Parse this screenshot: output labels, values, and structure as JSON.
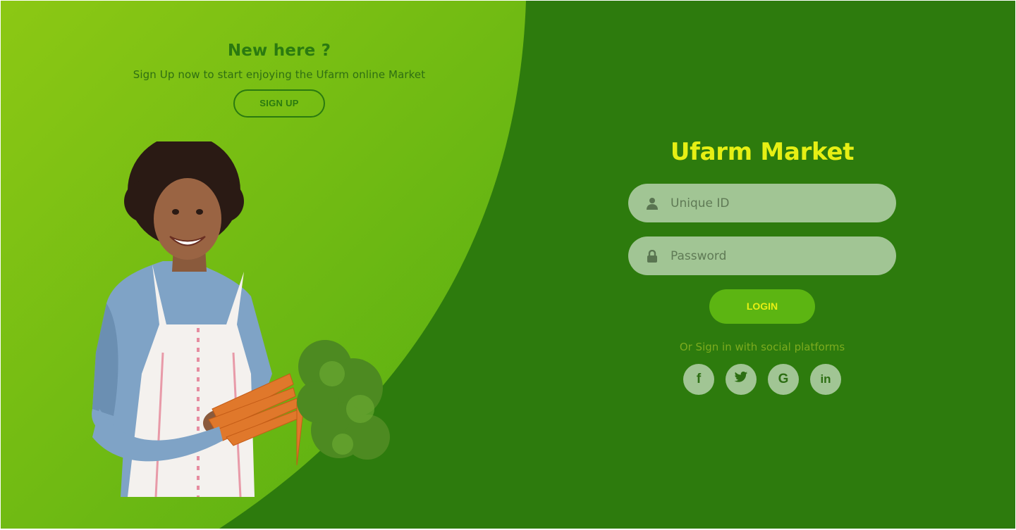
{
  "signup_panel": {
    "title": "New here ?",
    "subtitle": "Sign Up now to start enjoying the Ufarm online Market",
    "signup_label": "SIGN UP"
  },
  "login_panel": {
    "title": "Ufarm Market",
    "username_placeholder": "Unique ID",
    "password_placeholder": "Password",
    "login_label": "LOGIN",
    "social_text": "Or Sign in with social platforms",
    "social": [
      {
        "icon": "facebook-icon",
        "glyph": "f"
      },
      {
        "icon": "twitter-icon",
        "glyph": "🐦"
      },
      {
        "icon": "google-icon",
        "glyph": "G"
      },
      {
        "icon": "linkedin-icon",
        "glyph": "in"
      }
    ]
  },
  "colors": {
    "background_dark": "#2d7b0d",
    "background_light": "#8cc814",
    "accent_yellow": "#e6ef14",
    "field_bg": "#a1c594",
    "login_button": "#5cb512"
  }
}
